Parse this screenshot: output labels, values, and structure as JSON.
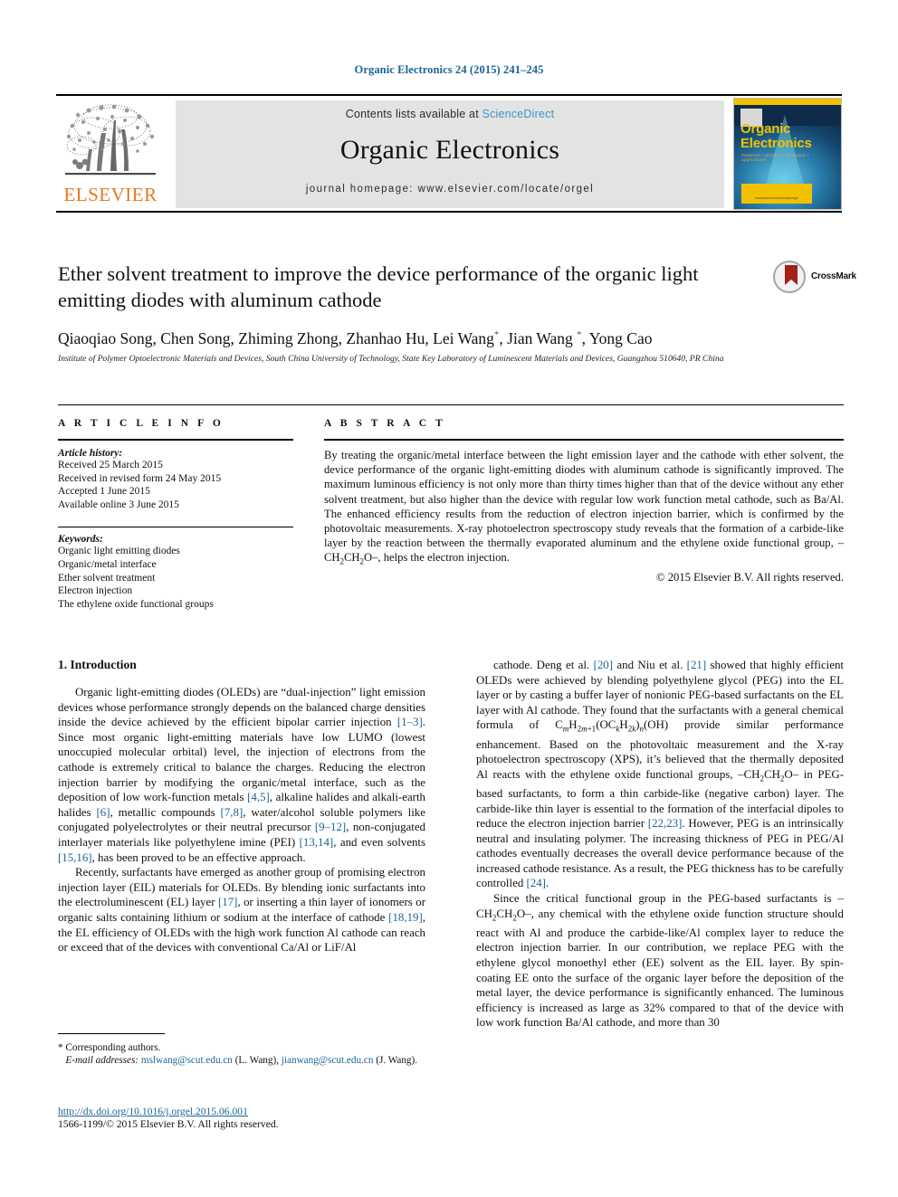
{
  "running_head": "Organic Electronics 24 (2015) 241–245",
  "masthead": {
    "publisher": "ELSEVIER",
    "contents_prefix": "Contents lists available at ",
    "contents_link": "ScienceDirect",
    "journal_name": "Organic Electronics",
    "homepage": "journal homepage: www.elsevier.com/locate/orgel",
    "cover": {
      "title_line1": "Organic",
      "title_line2": "Electronics",
      "subtitle": "materials • physics • chemistry • applications",
      "footer_text": "www.elsevier.com/locate/orgel"
    }
  },
  "article": {
    "title": "Ether solvent treatment to improve the device performance of the organic light emitting diodes with aluminum cathode",
    "crossmark_label": "CrossMark",
    "authors_html": "Qiaoqiao Song, Chen Song, Zhiming Zhong, Zhanhao Hu, Lei Wang<sup>*</sup>, Jian Wang <sup>*</sup>, Yong Cao",
    "affiliation": "Institute of Polymer Optoelectronic Materials and Devices, South China University of Technology, State Key Laboratory of Luminescent Materials and Devices, Guangzhou 510640, PR China"
  },
  "article_info": {
    "heading": "A R T I C L E    I N F O",
    "history_label": "Article history:",
    "history": [
      "Received 25 March 2015",
      "Received in revised form 24 May 2015",
      "Accepted 1 June 2015",
      "Available online 3 June 2015"
    ],
    "keywords_label": "Keywords:",
    "keywords": [
      "Organic light emitting diodes",
      "Organic/metal interface",
      "Ether solvent treatment",
      "Electron injection",
      "The ethylene oxide functional groups"
    ]
  },
  "abstract": {
    "heading": "A B S T R A C T",
    "text_html": "By treating the organic/metal interface between the light emission layer and the cathode with ether solvent, the device performance of the organic light-emitting diodes with aluminum cathode is significantly improved. The maximum luminous efficiency is not only more than thirty times higher than that of the device without any ether solvent treatment, but also higher than the device with regular low work function metal cathode, such as Ba/Al. The enhanced efficiency results from the reduction of electron injection barrier, which is confirmed by the photovoltaic measurements. X-ray photoelectron spectroscopy study reveals that the formation of a carbide-like layer by the reaction between the thermally evaporated aluminum and the ethylene oxide functional group, &ndash;CH<span class=\"sub\">2</span>CH<span class=\"sub\">2</span>O&ndash;, helps the electron injection.",
    "copyright": "© 2015 Elsevier B.V. All rights reserved."
  },
  "body": {
    "section_title": "1. Introduction",
    "left_paragraphs_html": [
      "Organic light-emitting diodes (OLEDs) are &ldquo;dual-injection&rdquo; light emission devices whose performance strongly depends on the balanced charge densities inside the device achieved by the efficient bipolar carrier injection <span class=\"ref\">[1&ndash;3]</span>. Since most organic light-emitting materials have low LUMO (lowest unoccupied molecular orbital) level, the injection of electrons from the cathode is extremely critical to balance the charges. Reducing the electron injection barrier by modifying the organic/metal interface, such as the deposition of low work-function metals <span class=\"ref\">[4,5]</span>, alkaline halides and alkali-earth halides <span class=\"ref\">[6]</span>, metallic compounds <span class=\"ref\">[7,8]</span>, water/alcohol soluble polymers like conjugated polyelectrolytes or their neutral precursor <span class=\"ref\">[9&ndash;12]</span>, non-conjugated interlayer materials like polyethylene imine (PEI) <span class=\"ref\">[13,14]</span>, and even solvents <span class=\"ref\">[15,16]</span>, has been proved to be an effective approach.",
      "Recently, surfactants have emerged as another group of promising electron injection layer (EIL) materials for OLEDs. By blending ionic surfactants into the electroluminescent (EL) layer <span class=\"ref\">[17]</span>, or inserting a thin layer of ionomers or organic salts containing lithium or sodium at the interface of cathode <span class=\"ref\">[18,19]</span>, the EL efficiency of OLEDs with the high work function Al cathode can reach or exceed that of the devices with conventional Ca/Al or LiF/Al"
    ],
    "right_paragraphs_html": [
      "cathode. Deng et al. <span class=\"ref\">[20]</span> and Niu et al. <span class=\"ref\">[21]</span> showed that highly efficient OLEDs were achieved by blending polyethylene glycol (PEG) into the EL layer or by casting a buffer layer of nonionic PEG-based surfactants on the EL layer with Al cathode. They found that the surfactants with a general chemical formula of C<span class=\"sub\"><i>m</i></span>H<span class=\"sub\">2<i>m</i>+1</span>(OC<span class=\"sub\"><i>k</i></span>H<span class=\"sub\">2<i>k</i></span>)<span class=\"sub\"><i>n</i></span>(OH) provide similar performance enhancement. Based on the photovoltaic measurement and the X-ray photoelectron spectroscopy (XPS), it&rsquo;s believed that the thermally deposited Al reacts with the ethylene oxide functional groups, &ndash;CH<span class=\"sub\">2</span>CH<span class=\"sub\">2</span>O&ndash; in PEG-based surfactants, to form a thin carbide-like (negative carbon) layer. The carbide-like thin layer is essential to the formation of the interfacial dipoles to reduce the electron injection barrier <span class=\"ref\">[22,23]</span>. However, PEG is an intrinsically neutral and insulating polymer. The increasing thickness of PEG in PEG/Al cathodes eventually decreases the overall device performance because of the increased cathode resistance. As a result, the PEG thickness has to be carefully controlled <span class=\"ref\">[24]</span>.",
      "Since the critical functional group in the PEG-based surfactants is &ndash;CH<span class=\"sub\">2</span>CH<span class=\"sub\">2</span>O&ndash;, any chemical with the ethylene oxide function structure should react with Al and produce the carbide-like/Al complex layer to reduce the electron injection barrier. In our contribution, we replace PEG with the ethylene glycol monoethyl ether (EE) solvent as the EIL layer. By spin-coating EE onto the surface of the organic layer before the deposition of the metal layer, the device performance is significantly enhanced. The luminous efficiency is increased as large as 32% compared to that of the device with low work function Ba/Al cathode, and more than 30"
    ]
  },
  "footnote": {
    "corresponding": "* Corresponding authors.",
    "email_label": "E-mail addresses:",
    "email1": "mslwang@scut.edu.cn",
    "email1_owner": "(L. Wang),",
    "email2": "jianwang@scut.edu.cn",
    "email2_owner": "(J. Wang)."
  },
  "footer": {
    "doi": "http://dx.doi.org/10.1016/j.orgel.2015.06.001",
    "issn_line": "1566-1199/© 2015 Elsevier B.V. All rights reserved."
  },
  "colors": {
    "link_blue": "#1a6496",
    "sciencedirect_blue": "#3a95c9",
    "elsevier_orange": "#e87722",
    "cover_yellow": "#f2c200",
    "cover_navy": "#0e2b4a"
  }
}
